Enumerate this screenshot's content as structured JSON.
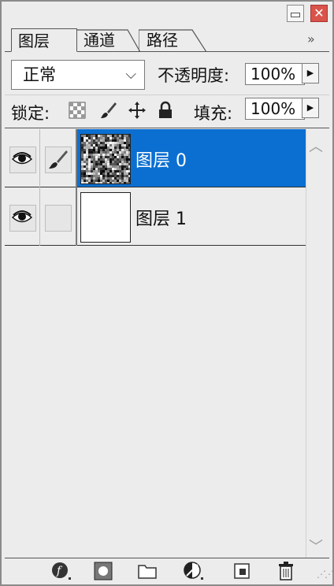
{
  "window": {
    "close_glyph": "✕"
  },
  "tabs": [
    {
      "label": "图层",
      "active": true
    },
    {
      "label": "通道",
      "active": false
    },
    {
      "label": "路径",
      "active": false
    }
  ],
  "more_glyph": "»",
  "blend": {
    "value": "正常",
    "chevron": "⌵"
  },
  "opacity": {
    "label": "不透明度:",
    "value": "100%",
    "arrow": "▶"
  },
  "lock": {
    "label": "锁定:",
    "icons": [
      "transparency-lock-icon",
      "brush-lock-icon",
      "move-lock-icon",
      "padlock-icon"
    ]
  },
  "fill": {
    "label": "填充:",
    "value": "100%",
    "arrow": "▶"
  },
  "layers": [
    {
      "name": "图层 0",
      "selected": true,
      "visible": true,
      "thumbnail": "noise"
    },
    {
      "name": "图层 1",
      "selected": false,
      "visible": true,
      "thumbnail": "blank"
    }
  ],
  "scroll": {
    "up_glyph": "︿",
    "down_glyph": "﹀"
  },
  "colors": {
    "selection": "#0b6fd1",
    "close": "#d9534a"
  }
}
